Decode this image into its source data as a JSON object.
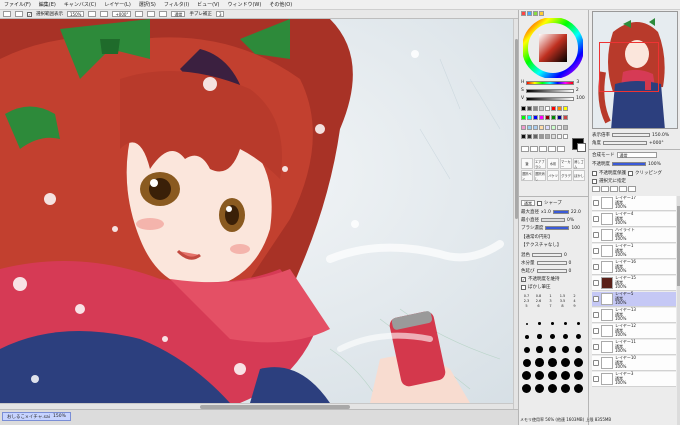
{
  "menu": [
    "ファイル(F)",
    "編集(E)",
    "キャンバス(C)",
    "レイヤー(L)",
    "選択(S)",
    "フィルタ(I)",
    "ビュー(V)",
    "ウィンドウ(W)",
    "その他(O)"
  ],
  "toolbar": {
    "sel_checkbox_label": "選択範囲表示",
    "zoom": "150%",
    "angle": "+000°",
    "mode": "通常",
    "stabilizer_label": "手ブレ補正",
    "stabilizer_value": "3"
  },
  "statusbar": {
    "tab_label": "おしるこ×イチャ.sai",
    "tab_zoom": "150%",
    "memory": "メモリ使用率 56% (他連 1603MB) 上限 8355MB"
  },
  "nav": {
    "zoom_label": "表示倍率",
    "zoom_value": "150.0%",
    "angle_label": "角度",
    "angle_value": "+000°"
  },
  "color_panel": {
    "sliders": [
      "H",
      "S",
      "V"
    ],
    "hsv_values": [
      "3",
      "2",
      "100"
    ],
    "brush_presets": [
      "筆",
      "エアブラシ",
      "水彩",
      "マーカー",
      "消しゴム",
      "選択ペン",
      "選択消し",
      "バケツ",
      "グラデ",
      "ぼかし"
    ]
  },
  "layer_props": {
    "blend_label": "合成モード",
    "blend_value": "通常",
    "opacity_label": "不透明度",
    "opacity_value": "100%",
    "protect_label": "不透明度保護",
    "clip_label": "クリッピング",
    "select_src_label": "選択元に指定"
  },
  "brush_settings": {
    "mode": "通常",
    "edge": "シャープ",
    "size_label": "最大直径",
    "size_value": "x1.0",
    "size_num": "22.0",
    "min_label": "最小直径",
    "min_value": "0%",
    "density_label": "ブラシ濃度",
    "density_value": "100",
    "shape_label": "【通常の円形】",
    "texture_label": "【テクスチャなし】",
    "blend_label": "混色",
    "blend_value": "0",
    "water_label": "水分量",
    "water_value": "0",
    "stretch_label": "色延び",
    "stretch_value": "0",
    "keep_opacity": "不透明度を維持",
    "blur_label": "ぼかし筆圧",
    "size_grid": [
      "0.7",
      "0.8",
      "1",
      "1.5",
      "2",
      "2.3",
      "2.6",
      "3",
      "3.5",
      "4",
      "5",
      "6",
      "7",
      "8",
      "9"
    ]
  },
  "layers": [
    {
      "name": "レイヤー17",
      "mode": "通常",
      "opacity": "100%",
      "selected": false
    },
    {
      "name": "レイヤー4",
      "mode": "通常",
      "opacity": "100%",
      "selected": false
    },
    {
      "name": "ハイライト",
      "mode": "通常",
      "opacity": "100%",
      "selected": false
    },
    {
      "name": "レイヤー1",
      "mode": "通常",
      "opacity": "100%",
      "selected": false
    },
    {
      "name": "レイヤー16",
      "mode": "通常",
      "opacity": "100%",
      "selected": false
    },
    {
      "name": "レイヤー15",
      "mode": "通常",
      "opacity": "100%",
      "selected": false
    },
    {
      "name": "レイヤー5",
      "mode": "通常",
      "opacity": "100%",
      "selected": true
    },
    {
      "name": "レイヤー13",
      "mode": "通常",
      "opacity": "100%",
      "selected": false
    },
    {
      "name": "レイヤー12",
      "mode": "通常",
      "opacity": "100%",
      "selected": false
    },
    {
      "name": "レイヤー11",
      "mode": "通常",
      "opacity": "100%",
      "selected": false
    },
    {
      "name": "レイヤー10",
      "mode": "通常",
      "opacity": "100%",
      "selected": false
    },
    {
      "name": "レイヤー3",
      "mode": "通常",
      "opacity": "100%",
      "selected": false
    }
  ]
}
